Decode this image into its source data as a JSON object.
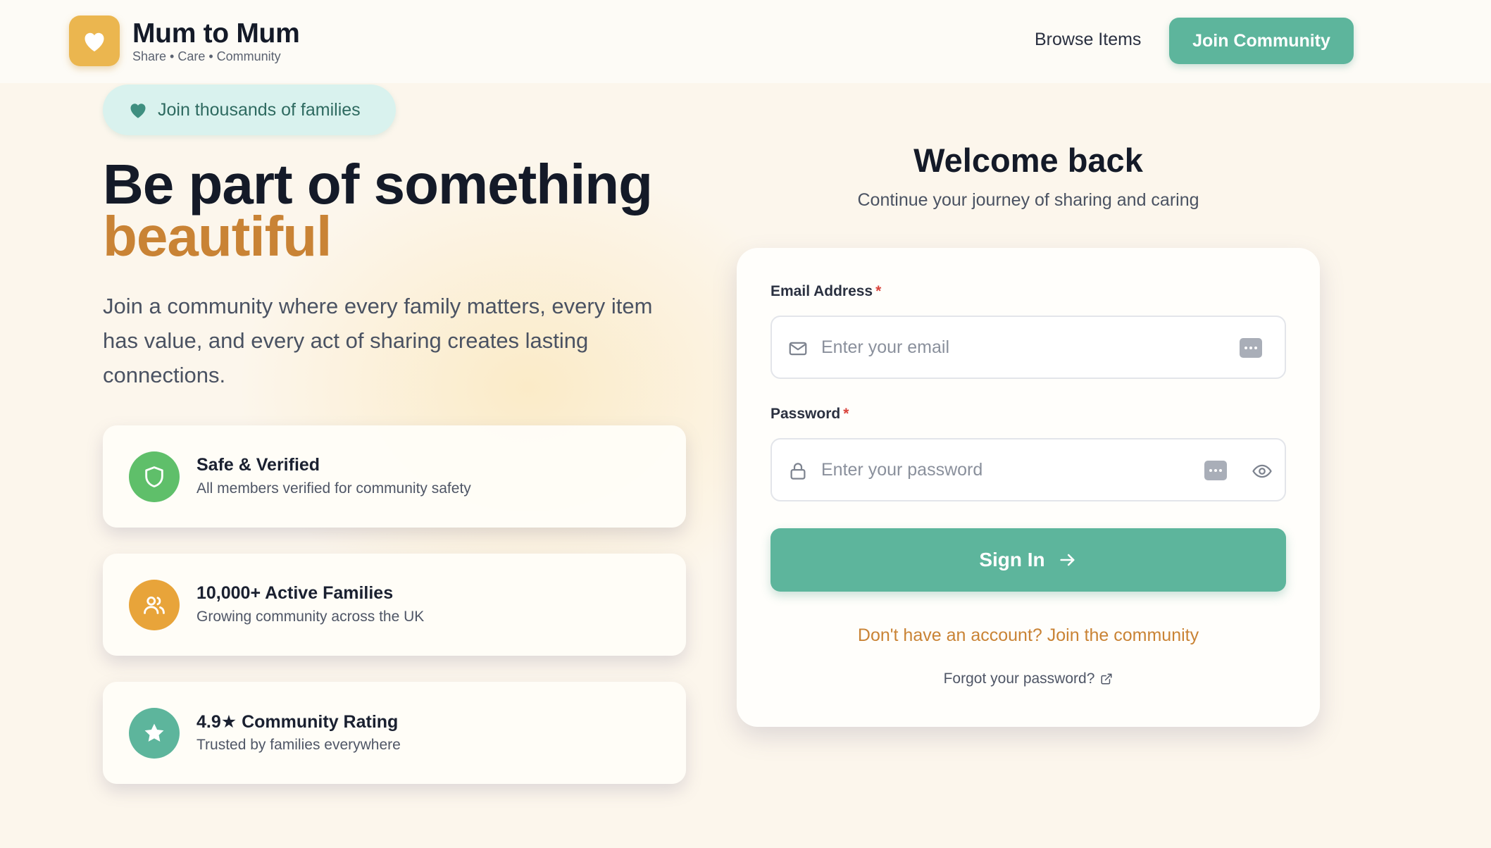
{
  "header": {
    "brand_name": "Mum to Mum",
    "brand_tagline": "Share • Care • Community",
    "nav_browse": "Browse Items",
    "nav_join": "Join Community"
  },
  "hero": {
    "pill_text": "Join thousands of families",
    "title_line1": "Be part of something",
    "title_line2": "beautiful",
    "description": "Join a community where every family matters, every item has value, and every act of sharing creates lasting connections."
  },
  "features": [
    {
      "icon": "shield-icon",
      "title": "Safe & Verified",
      "subtitle": "All members verified for community safety",
      "color": "#5fbf6a"
    },
    {
      "icon": "users-icon",
      "title": "10,000+ Active Families",
      "subtitle": "Growing community across the UK",
      "color": "#e8a43a"
    },
    {
      "icon": "star-icon",
      "title": "4.9★ Community Rating",
      "subtitle": "Trusted by families everywhere",
      "color": "#5db59c"
    }
  ],
  "login": {
    "title": "Welcome back",
    "subtitle": "Continue your journey of sharing and caring",
    "email_label": "Email Address",
    "email_placeholder": "Enter your email",
    "password_label": "Password",
    "password_placeholder": "Enter your password",
    "required_mark": "*",
    "submit_label": "Sign In",
    "signup_link": "Don't have an account? Join the community",
    "forgot_link": "Forgot your password?"
  },
  "colors": {
    "accent_teal": "#5db59c",
    "accent_orange": "#c98335",
    "logo_yellow": "#ebb64f",
    "background": "#fcf6ec"
  }
}
